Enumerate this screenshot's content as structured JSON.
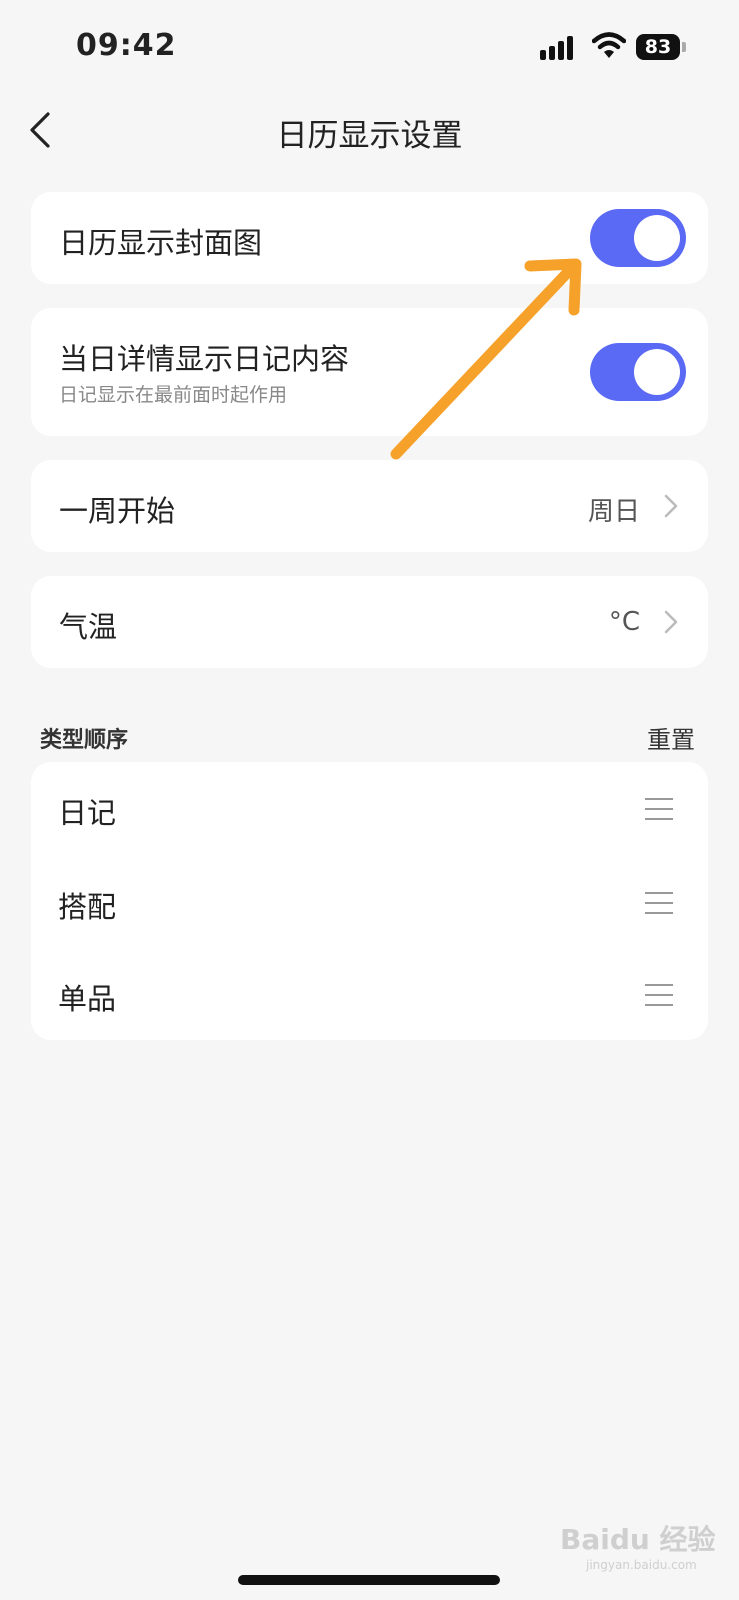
{
  "status_bar": {
    "time": "09:42",
    "battery": "83"
  },
  "nav": {
    "title": "日历显示设置"
  },
  "settings": {
    "cover_image": {
      "label": "日历显示封面图",
      "enabled": true
    },
    "diary_detail": {
      "label": "当日详情显示日记内容",
      "sublabel": "日记显示在最前面时起作用",
      "enabled": true
    },
    "week_start": {
      "label": "一周开始",
      "value": "周日"
    },
    "temperature": {
      "label": "气温",
      "value": "°C"
    }
  },
  "type_order": {
    "title": "类型顺序",
    "reset_label": "重置",
    "items": [
      "日记",
      "搭配",
      "单品"
    ]
  },
  "watermark": {
    "brand": "Baidu 经验",
    "url": "jingyan.baidu.com"
  },
  "colors": {
    "toggle_on": "#5b6af5",
    "arrow": "#f5a12a",
    "background": "#f6f6f6"
  },
  "icons": {
    "back": "chevron-left-icon",
    "chevron": "chevron-right-icon",
    "drag": "drag-handle-icon"
  }
}
